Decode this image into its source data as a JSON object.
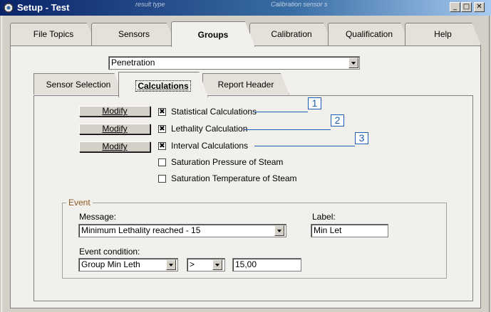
{
  "window": {
    "title": "Setup - Test",
    "ghost_text_left": "result type",
    "ghost_text_right": "Calibration sensor s",
    "minimize_icon": "minimize-icon",
    "maximize_icon": "maximize-icon",
    "close_icon": "close-icon"
  },
  "main_tabs": [
    "File Topics",
    "Sensors",
    "Groups",
    "Calibration",
    "Qualification",
    "Help"
  ],
  "group_select": {
    "value": "Penetration"
  },
  "sub_tabs": [
    "Sensor Selection",
    "Calculations",
    "Report Header"
  ],
  "calculations": {
    "modify_label": "Modify",
    "items": [
      {
        "label": "Statistical Calculations",
        "checked": true,
        "callout": "1"
      },
      {
        "label": "Lethality Calculation",
        "checked": true,
        "callout": "2"
      },
      {
        "label": "Interval Calculations",
        "checked": true,
        "callout": "3"
      },
      {
        "label": "Saturation Pressure of Steam",
        "checked": false
      },
      {
        "label": "Saturation Temperature of Steam",
        "checked": false
      }
    ],
    "check_mark": "✖"
  },
  "event": {
    "group_label": "Event",
    "message_label": "Message:",
    "message_value": "Minimum Lethality reached - 15",
    "label_label": "Label:",
    "label_value": "Min Let",
    "condition_label": "Event condition:",
    "condition_field": "Group Min Leth",
    "condition_operator": ">",
    "condition_value": "15,00"
  },
  "colors": {
    "titlebar": "#0a246a",
    "callout": "#1a5fb4",
    "panel": "#f2f0ec"
  }
}
